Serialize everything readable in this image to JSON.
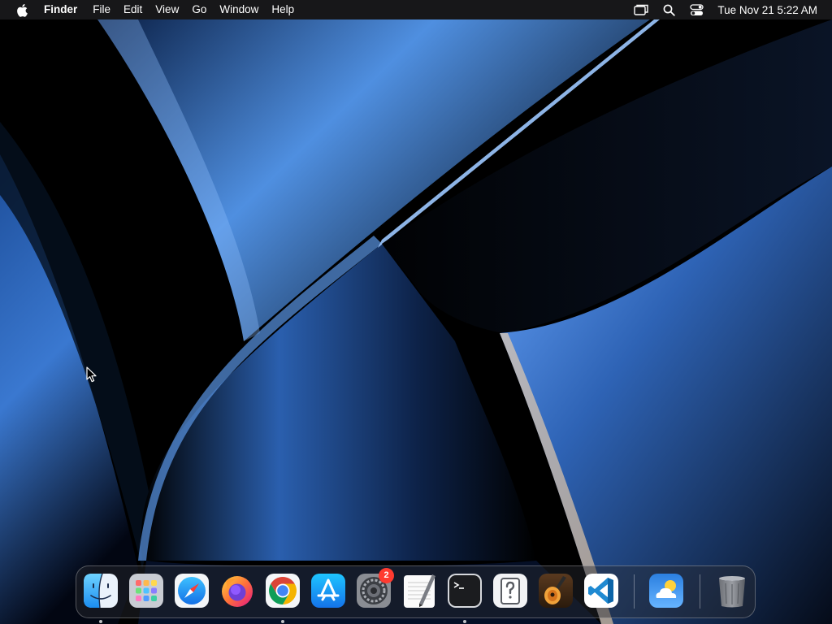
{
  "menubar": {
    "app_name": "Finder",
    "menus": [
      "File",
      "Edit",
      "View",
      "Go",
      "Window",
      "Help"
    ],
    "status_icons": [
      "screen-mirroring-icon",
      "spotlight-search-icon",
      "control-center-icon"
    ],
    "clock": "Tue Nov 21  5:22 AM"
  },
  "dock": {
    "apps": [
      {
        "name": "Finder",
        "icon": "finder-icon",
        "running": true
      },
      {
        "name": "Launchpad",
        "icon": "launchpad-icon",
        "running": false
      },
      {
        "name": "Safari",
        "icon": "safari-icon",
        "running": false
      },
      {
        "name": "Firefox",
        "icon": "firefox-icon",
        "running": false
      },
      {
        "name": "Google Chrome",
        "icon": "chrome-icon",
        "running": true
      },
      {
        "name": "App Store",
        "icon": "app-store-icon",
        "running": false
      },
      {
        "name": "System Settings",
        "icon": "system-settings-icon",
        "running": false,
        "badge": "2"
      },
      {
        "name": "TextEdit",
        "icon": "textedit-icon",
        "running": false
      },
      {
        "name": "Terminal",
        "icon": "terminal-icon",
        "running": true
      },
      {
        "name": "Preview",
        "icon": "preview-icon",
        "running": false
      },
      {
        "name": "GarageBand",
        "icon": "garageband-icon",
        "running": false
      },
      {
        "name": "Visual Studio Code",
        "icon": "vscode-icon",
        "running": false
      },
      {
        "name": "Weather",
        "icon": "weather-icon",
        "running": false
      },
      {
        "name": "Trash",
        "icon": "trash-icon",
        "running": false
      }
    ]
  },
  "colors": {
    "menubar_bg": "#1c1c1e",
    "badge": "#ff3b30",
    "wallpaper_accent": "#4a8fe8"
  }
}
